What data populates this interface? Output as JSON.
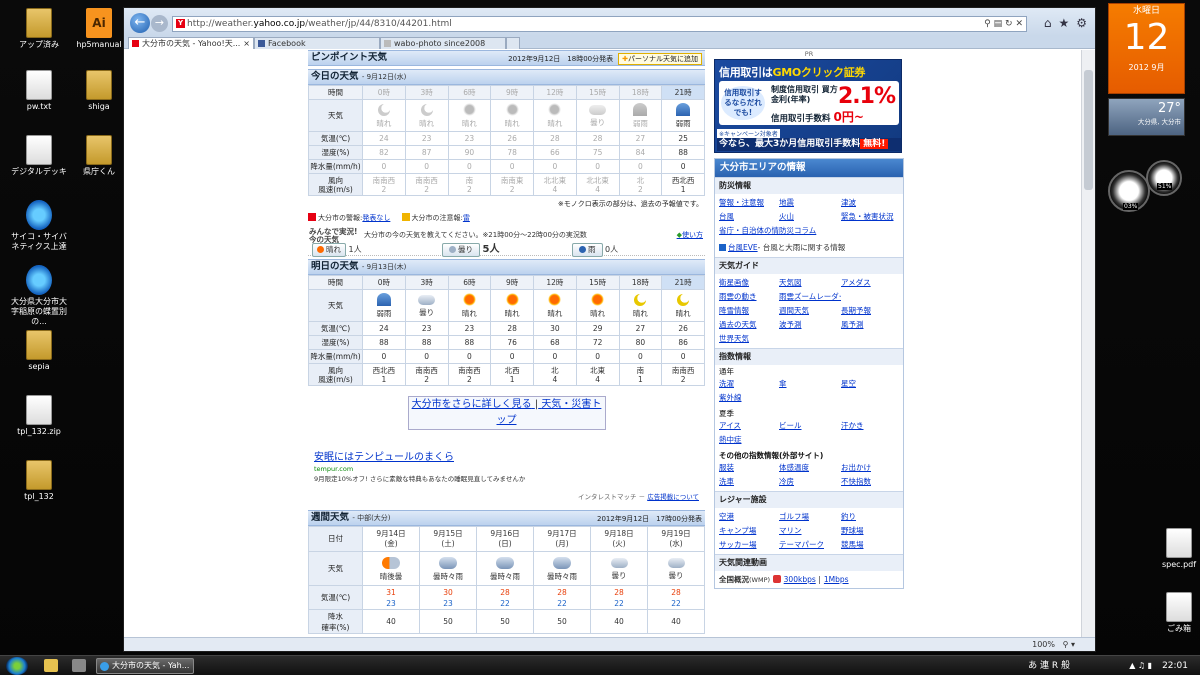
{
  "desktop": {
    "icons": [
      {
        "label": "アップ済み",
        "type": "folder"
      },
      {
        "label": "hp5manual",
        "type": "ai"
      },
      {
        "label": "pw.txt",
        "type": "doc"
      },
      {
        "label": "shiga",
        "type": "folder"
      },
      {
        "label": "デジタルデッキ",
        "type": "doc"
      },
      {
        "label": "県庁くん",
        "type": "folder"
      },
      {
        "label": "サイコ・サイバネティクス上達",
        "type": "ie"
      },
      {
        "label": "大分県大分市大字稲原の蝶置別の...",
        "type": "ie"
      },
      {
        "label": "sepia",
        "type": "folder"
      },
      {
        "label": "tpl_132.zip",
        "type": "doc"
      },
      {
        "label": "tpl_132",
        "type": "folder"
      },
      {
        "label": "spec.pdf",
        "type": "doc"
      },
      {
        "label": "ごみ箱",
        "type": "doc"
      }
    ]
  },
  "calendar_gadget": {
    "weekday": "水曜日",
    "day": "12",
    "year_month": "2012 9月"
  },
  "weather_gadget": {
    "temp": "27°",
    "location": "大分県, 大分市"
  },
  "cpu_gadget": {
    "cpu": "03%",
    "mem": "51%"
  },
  "browser": {
    "url_prefix": "http://weather.",
    "url_domain": "yahoo.co.jp",
    "url_path": "/weather/jp/44/8310/44201.html",
    "tabs": [
      {
        "label": "大分市の天気 - Yahoo!天...",
        "active": true,
        "icon": "yahoo-icon"
      },
      {
        "label": "Facebook",
        "active": false,
        "icon": "facebook-icon"
      },
      {
        "label": "wabo-photo since2008",
        "active": false,
        "icon": "page-icon"
      }
    ],
    "zoom": "100%"
  },
  "pinpoint": {
    "title": "ピンポイント天気",
    "issued": "2012年9月12日　18時00分発表",
    "personal_btn": "パーソナル天気に追加"
  },
  "today": {
    "title": "今日の天気",
    "date": "- 9月12日(水)",
    "row_labels": {
      "time": "時間",
      "weather": "天気",
      "temp": "気温(℃)",
      "humidity": "湿度(%)",
      "rain": "降水量(mm/h)",
      "wind_dir": "風向",
      "wind_speed": "風速(m/s)"
    },
    "hours": [
      {
        "time": "0時",
        "weather": "晴れ",
        "icon": "moonp",
        "temp": "24",
        "hum": "82",
        "rain": "0",
        "dir": "南南西",
        "spd": "2",
        "past": true
      },
      {
        "time": "3時",
        "weather": "晴れ",
        "icon": "moonp",
        "temp": "23",
        "hum": "87",
        "rain": "0",
        "dir": "南南西",
        "spd": "2",
        "past": true
      },
      {
        "time": "6時",
        "weather": "晴れ",
        "icon": "sunp",
        "temp": "23",
        "hum": "90",
        "rain": "0",
        "dir": "南",
        "spd": "2",
        "past": true
      },
      {
        "time": "9時",
        "weather": "晴れ",
        "icon": "sunp",
        "temp": "26",
        "hum": "78",
        "rain": "0",
        "dir": "南南東",
        "spd": "2",
        "past": true
      },
      {
        "time": "12時",
        "weather": "晴れ",
        "icon": "sunp",
        "temp": "28",
        "hum": "66",
        "rain": "0",
        "dir": "北北東",
        "spd": "4",
        "past": true
      },
      {
        "time": "15時",
        "weather": "曇り",
        "icon": "cloudp",
        "temp": "28",
        "hum": "75",
        "rain": "0",
        "dir": "北北東",
        "spd": "4",
        "past": true
      },
      {
        "time": "18時",
        "weather": "弱雨",
        "icon": "umbp",
        "temp": "27",
        "hum": "84",
        "rain": "0",
        "dir": "北",
        "spd": "2",
        "past": true
      },
      {
        "time": "21時",
        "weather": "弱雨",
        "icon": "umb",
        "temp": "25",
        "hum": "88",
        "rain": "0",
        "dir": "西北西",
        "spd": "1",
        "past": false
      }
    ],
    "note": "※モノクロ表示の部分は、過去の予報値です。",
    "warn_label": "大分市の警報:",
    "warn_value": "発表なし",
    "advisory_label": "大分市の注意報:",
    "advisory_value": "雷"
  },
  "minna": {
    "logo": "みんなで実況! 今の天気",
    "question": "大分市の今の天気を教えてください。※21時00分～22時00分の実況数",
    "howto": "使い方",
    "votes": [
      {
        "label": "晴れ",
        "count": "1人"
      },
      {
        "label": "曇り",
        "count": "5人"
      },
      {
        "label": "雨",
        "count": "0人"
      }
    ]
  },
  "tomorrow": {
    "title": "明日の天気",
    "date": "- 9月13日(木)",
    "hours": [
      {
        "time": "0時",
        "weather": "弱雨",
        "icon": "umb",
        "temp": "24",
        "hum": "88",
        "rain": "0",
        "dir": "西北西",
        "spd": "1"
      },
      {
        "time": "3時",
        "weather": "曇り",
        "icon": "cloud",
        "temp": "23",
        "hum": "88",
        "rain": "0",
        "dir": "南南西",
        "spd": "2"
      },
      {
        "time": "6時",
        "weather": "晴れ",
        "icon": "sun",
        "temp": "23",
        "hum": "88",
        "rain": "0",
        "dir": "南南西",
        "spd": "2"
      },
      {
        "time": "9時",
        "weather": "晴れ",
        "icon": "sun",
        "temp": "28",
        "hum": "76",
        "rain": "0",
        "dir": "北西",
        "spd": "1"
      },
      {
        "time": "12時",
        "weather": "晴れ",
        "icon": "sun",
        "temp": "30",
        "hum": "68",
        "rain": "0",
        "dir": "北",
        "spd": "4"
      },
      {
        "time": "15時",
        "weather": "晴れ",
        "icon": "sun",
        "temp": "29",
        "hum": "72",
        "rain": "0",
        "dir": "北東",
        "spd": "4"
      },
      {
        "time": "18時",
        "weather": "晴れ",
        "icon": "moon",
        "temp": "27",
        "hum": "80",
        "rain": "0",
        "dir": "南",
        "spd": "1"
      },
      {
        "time": "21時",
        "weather": "晴れ",
        "icon": "moon",
        "temp": "26",
        "hum": "86",
        "rain": "0",
        "dir": "南南西",
        "spd": "2"
      }
    ]
  },
  "links": {
    "detail": "大分市をさらに詳しく見る",
    "sep": "|",
    "top": "天気・災害トップ"
  },
  "ad": {
    "title": "安眠にはテンピュールのまくら",
    "domain": "tempur.com",
    "desc": "9月限定10%オフ! さらに素敵な特典もあなたの睡眠見直してみませんか",
    "credit": "インタレストマッチ －",
    "credit_link": "広告掲載について"
  },
  "weekly": {
    "title": "週間天気",
    "region": "- 中部(大分)",
    "issued": "2012年9月12日　17時00分発表",
    "row_labels": {
      "date": "日付",
      "weather": "天気",
      "temp": "気温(℃)",
      "rain_a": "降水",
      "rain_b": "確率(%)"
    },
    "days": [
      {
        "date": "9月14日",
        "dow": "(金)",
        "weather": "晴後曇",
        "icon": "mix",
        "hi": "31",
        "lo": "23",
        "pop": "40"
      },
      {
        "date": "9月15日",
        "dow": "(土)",
        "weather": "曇時々雨",
        "icon": "cr",
        "hi": "30",
        "lo": "23",
        "pop": "50"
      },
      {
        "date": "9月16日",
        "dow": "(日)",
        "weather": "曇時々雨",
        "icon": "cr",
        "hi": "28",
        "lo": "22",
        "pop": "50"
      },
      {
        "date": "9月17日",
        "dow": "(月)",
        "weather": "曇時々雨",
        "icon": "cr",
        "hi": "28",
        "lo": "22",
        "pop": "50"
      },
      {
        "date": "9月18日",
        "dow": "(火)",
        "weather": "曇り",
        "icon": "cloud",
        "hi": "28",
        "lo": "22",
        "pop": "40"
      },
      {
        "date": "9月19日",
        "dow": "(水)",
        "weather": "曇り",
        "icon": "cloud",
        "hi": "28",
        "lo": "22",
        "pop": "40"
      }
    ]
  },
  "banner": {
    "pr": "PR",
    "line1": "信用取引は",
    "brand": "GMOクリック証券",
    "bubble": "信用取引するならだれでも!",
    "rate_label": "制度信用取引 買方金利(年率)",
    "rate": "2.1%",
    "fee_label": "信用取引手数料",
    "fee": "0円~",
    "campaign": "※キャンペーン対象者",
    "foot": "今なら、最大3か月信用取引手数料",
    "foot_free": "無料!"
  },
  "area": {
    "title": "大分市エリアの情報",
    "bousai": {
      "head": "防災情報",
      "links": [
        "警報・注意報",
        "地震",
        "津波",
        "台風",
        "火山",
        "緊急・被害状況",
        "省庁・自治体の情報",
        "防災コラム"
      ]
    },
    "eve": {
      "link": "台風EVE",
      "text": "- 台風と大雨に関する情報"
    },
    "guide": {
      "head": "天気ガイド",
      "links": [
        "衛星画像",
        "天気図",
        "アメダス",
        "雨雲の動き",
        "雨雲ズームレーダー",
        "",
        "降雪情報",
        "週間天気",
        "長期予報",
        "過去の天気",
        "波予測",
        "風予測",
        "世界天気"
      ]
    },
    "index": {
      "head": "指数情報",
      "year_label": "通年",
      "year_links": [
        "洗濯",
        "傘",
        "星空",
        "紫外線"
      ],
      "summer_label": "夏季",
      "summer_links": [
        "アイス",
        "ビール",
        "汗かき",
        "熱中症"
      ],
      "other_label": "その他の指数情報(外部サイト)",
      "other_links": [
        "服装",
        "体感温度",
        "お出かけ",
        "洗車",
        "冷房",
        "不快指数"
      ]
    },
    "leisure": {
      "head": "レジャー施設",
      "links": [
        "空港",
        "ゴルフ場",
        "釣り",
        "キャンプ場",
        "マリン",
        "野球場",
        "サッカー場",
        "テーマパーク",
        "競馬場"
      ]
    },
    "video": {
      "head": "天気関連動画",
      "label": "全国概況",
      "format": "(WMP)",
      "link1": "300kbps",
      "sep": "|",
      "link2": "1Mbps"
    }
  },
  "taskbar": {
    "item": "大分市の天気 - Yah...",
    "ime": "あ 連 R 般",
    "time": "22:01"
  }
}
